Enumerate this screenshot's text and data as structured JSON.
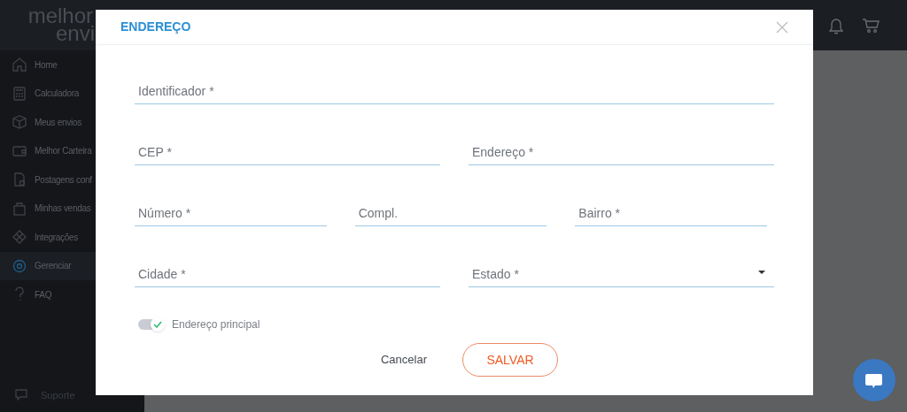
{
  "logo": {
    "line_1": "melhor",
    "line_2": "envi"
  },
  "sidebar": {
    "items": [
      {
        "label": "Home",
        "selected": false
      },
      {
        "label": "Calculadora",
        "selected": false
      },
      {
        "label": "Meus envios",
        "selected": false
      },
      {
        "label": "Melhor Carteira",
        "selected": false
      },
      {
        "label": "Postagens conf",
        "selected": false
      },
      {
        "label": "Minhas vendas",
        "selected": false
      },
      {
        "label": "Integrações",
        "selected": false
      },
      {
        "label": "Gerenciar",
        "selected": true
      },
      {
        "label": "FAQ",
        "selected": false
      }
    ],
    "footer": "Suporte"
  },
  "modal": {
    "title": "ENDEREÇO",
    "rows": [
      [
        {
          "placeholder": "Identificador *",
          "kind": "text"
        }
      ],
      [
        {
          "placeholder": "CEP *",
          "kind": "text"
        },
        {
          "placeholder": "Endereço *",
          "kind": "text"
        }
      ],
      [
        {
          "placeholder": "Número *",
          "kind": "text"
        },
        {
          "placeholder": "Compl.",
          "kind": "text"
        },
        {
          "placeholder": "Bairro *",
          "kind": "text"
        }
      ],
      [
        {
          "placeholder": "Cidade *",
          "kind": "text"
        },
        {
          "placeholder": "Estado *",
          "kind": "select"
        }
      ]
    ],
    "toggle": {
      "label": "Endereço principal",
      "on": true
    },
    "buttons": {
      "cancel": "Cancelar",
      "save": "SALVAR"
    }
  }
}
